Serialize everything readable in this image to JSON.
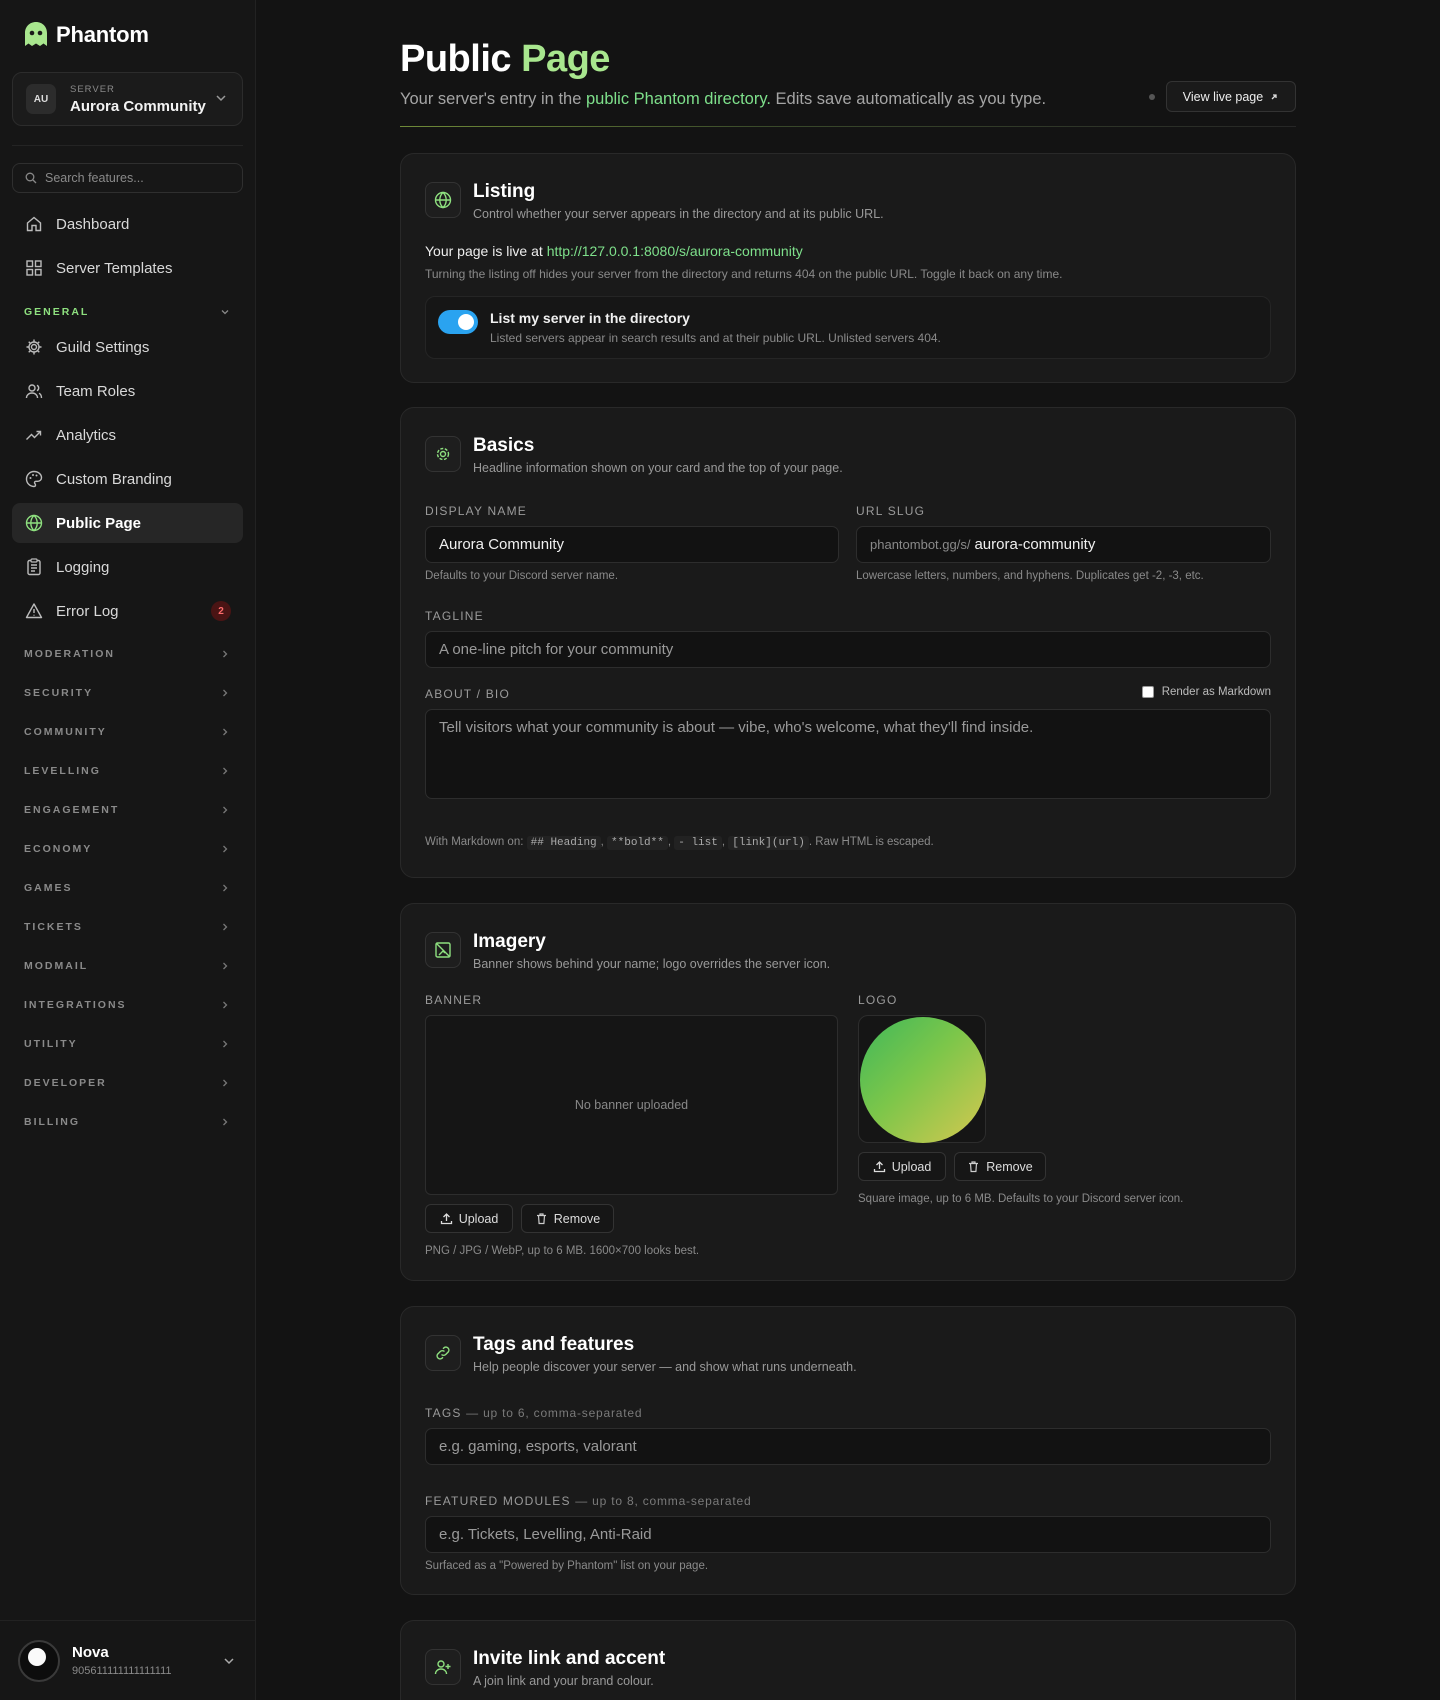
{
  "brand": {
    "name": "Phantom"
  },
  "server": {
    "avatar": "AU",
    "label": "SERVER",
    "name": "Aurora Community"
  },
  "search": {
    "placeholder": "Search features..."
  },
  "nav": {
    "top": [
      {
        "label": "Dashboard",
        "icon": "home-icon"
      },
      {
        "label": "Server Templates",
        "icon": "grid-icon"
      }
    ],
    "general_label": "GENERAL",
    "general": [
      {
        "label": "Guild Settings",
        "icon": "gear-icon"
      },
      {
        "label": "Team Roles",
        "icon": "users-icon"
      },
      {
        "label": "Analytics",
        "icon": "trend-icon"
      },
      {
        "label": "Custom Branding",
        "icon": "palette-icon"
      },
      {
        "label": "Public Page",
        "icon": "globe-icon",
        "active": true
      },
      {
        "label": "Logging",
        "icon": "clipboard-icon"
      },
      {
        "label": "Error Log",
        "icon": "warning-icon",
        "badge": "2"
      }
    ],
    "sections": [
      "MODERATION",
      "SECURITY",
      "COMMUNITY",
      "LEVELLING",
      "ENGAGEMENT",
      "ECONOMY",
      "GAMES",
      "TICKETS",
      "MODMAIL",
      "INTEGRATIONS",
      "UTILITY",
      "DEVELOPER",
      "BILLING"
    ]
  },
  "user": {
    "name": "Nova",
    "id": "905611111111111111"
  },
  "page": {
    "title_a": "Public",
    "title_b": "Page",
    "subtitle_a": "Your server's entry in the",
    "subtitle_link": "public Phantom directory.",
    "subtitle_b": "Edits save automatically as you type.",
    "live_button": "View live page"
  },
  "listing": {
    "title": "Listing",
    "desc": "Control whether your server appears in the directory and at its public URL.",
    "live_prefix": "Your page is live at",
    "live_url": "http://127.0.0.1:8080/s/aurora-community",
    "live_help": "Turning the listing off hides your server from the directory and returns 404 on the public URL. Toggle it back on any time.",
    "toggle_label": "List my server in the directory",
    "toggle_help": "Listed servers appear in search results and at their public URL. Unlisted servers 404.",
    "toggle_on": true
  },
  "basics": {
    "title": "Basics",
    "desc": "Headline information shown on your card and the top of your page.",
    "display_name_label": "DISPLAY NAME",
    "display_name_value": "Aurora Community",
    "display_name_help": "Defaults to your Discord server name.",
    "slug_label": "URL SLUG",
    "slug_prefix": "phantombot.gg/s/",
    "slug_value": "aurora-community",
    "slug_help": "Lowercase letters, numbers, and hyphens. Duplicates get -2, -3, etc.",
    "tagline_label": "TAGLINE",
    "tagline_placeholder": "A one-line pitch for your community",
    "about_label": "ABOUT / BIO",
    "markdown_label": "Render as Markdown",
    "about_placeholder": "Tell visitors what your community is about — vibe, who's welcome, what they'll find inside.",
    "md_help_prefix": "With Markdown on:",
    "md_codes": [
      "## Heading",
      "**bold**",
      "- list",
      "[link](url)"
    ],
    "md_help_suffix": ". Raw HTML is escaped."
  },
  "imagery": {
    "title": "Imagery",
    "desc": "Banner shows behind your name; logo overrides the server icon.",
    "banner_label": "BANNER",
    "banner_empty": "No banner uploaded",
    "upload": "Upload",
    "remove": "Remove",
    "banner_help": "PNG / JPG / WebP, up to 6 MB. 1600×700 looks best.",
    "logo_label": "LOGO",
    "logo_help": "Square image, up to 6 MB. Defaults to your Discord server icon."
  },
  "tags": {
    "title": "Tags and features",
    "desc": "Help people discover your server — and show what runs underneath.",
    "tags_label": "TAGS",
    "tags_hint": "— up to 6, comma-separated",
    "tags_placeholder": "e.g. gaming, esports, valorant",
    "modules_label": "FEATURED MODULES",
    "modules_hint": "— up to 8, comma-separated",
    "modules_placeholder": "e.g. Tickets, Levelling, Anti-Raid",
    "modules_help": "Surfaced as a \"Powered by Phantom\" list on your page."
  },
  "invite": {
    "title": "Invite link and accent",
    "desc": "A join link and your brand colour."
  },
  "colors": {
    "accent_green": "#8ee07f",
    "toggle_blue": "#2aa3f0",
    "badge_red": "#ff6b6b"
  }
}
